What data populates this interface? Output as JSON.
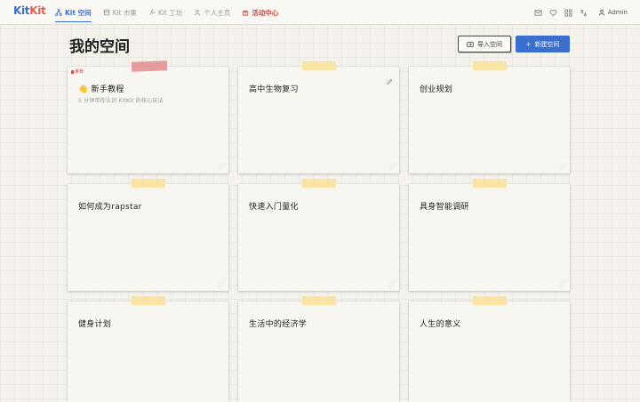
{
  "brand": {
    "logo_part1": "Kit",
    "logo_part2": "Kit"
  },
  "nav": {
    "items": [
      {
        "label": "Kit 空间",
        "icon": "network-icon",
        "active": true
      },
      {
        "label": "Kit 市集",
        "icon": "store-icon",
        "active": false
      },
      {
        "label": "Kit 工坊",
        "icon": "wrench-icon",
        "active": false
      },
      {
        "label": "个人主页",
        "icon": "user-icon",
        "active": false
      },
      {
        "label": "活动中心",
        "icon": "gift-icon",
        "active": false
      }
    ],
    "user_name": "Admin"
  },
  "page": {
    "title": "我的空间",
    "import_label": "导入空间",
    "new_label": "新建空间",
    "new_plus": "+"
  },
  "cards": [
    {
      "title": "新手教程",
      "emoji": "👋",
      "badge": "推荐",
      "subtitle": "5 分钟带你认识 KitKit 的核心玩法"
    },
    {
      "title": "高中生物复习"
    },
    {
      "title": "创业规划"
    },
    {
      "title": "如何成为rapstar"
    },
    {
      "title": "快速入门量化"
    },
    {
      "title": "具身智能调研"
    },
    {
      "title": "健身计划"
    },
    {
      "title": "生活中的经济学"
    },
    {
      "title": "人生的意义"
    }
  ],
  "colors": {
    "accent": "#3a6fd0",
    "event": "#d0453a",
    "tape": "#fae296"
  }
}
